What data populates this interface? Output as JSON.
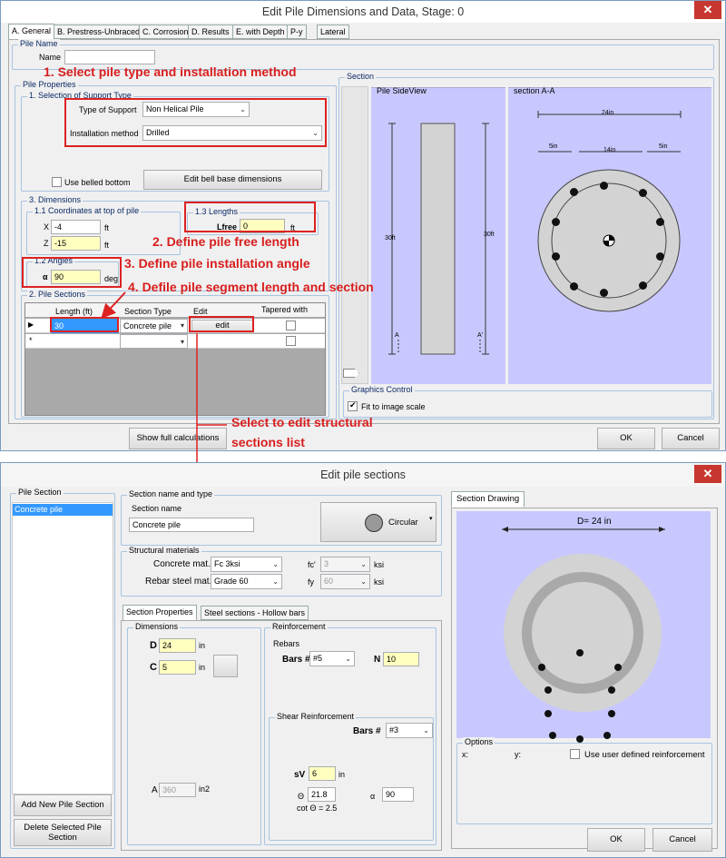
{
  "top_window": {
    "title": "Edit Pile Dimensions and Data, Stage: 0",
    "close_label": "✕",
    "tabs": [
      "A. General",
      "B. Prestress-Unbraced",
      "C. Corrosion",
      "D. Results",
      "E. with Depth",
      "P-y",
      "Lateral"
    ],
    "pile_name_group": "Pile Name",
    "name_label": "Name",
    "name_value": "",
    "pile_props_group": "Pile Properties",
    "support_group": "1. Selection of Support Type",
    "type_label": "Type of Support",
    "type_value": "Non Helical Pile",
    "install_label": "Installation method",
    "install_value": "Drilled",
    "belled_label": "Use belled bottom",
    "bell_button": "Edit bell base dimensions",
    "dims_group": "3. Dimensions",
    "coords_group": "1.1 Coordinates at top of pile",
    "x_label": "X",
    "x_value": "-4",
    "z_label": "Z",
    "z_value": "-15",
    "ft": "ft",
    "lengths_group": "1.3 Lengths",
    "lfree_label": "Lfree",
    "lfree_value": "0",
    "angles_group": "1.2 Angles",
    "alpha_label": "α",
    "alpha_value": "90",
    "deg": "deg",
    "sections_group": "2. Pile Sections",
    "table_headers": [
      "Length (ft)",
      "Section Type",
      "Edit",
      "Tapered with"
    ],
    "row1": {
      "length": "30",
      "section": "Concrete pile",
      "edit": "edit"
    },
    "new_row_marker": "*",
    "section_group": "Section",
    "side_view": "Pile SideView",
    "section_aa": "section A-A",
    "dim_24": "24in",
    "dim_5a": "5in",
    "dim_14": "14in",
    "dim_5b": "5in",
    "dim_30a": "30ft",
    "dim_30b": "30ft",
    "a_left": "A",
    "a_right": "A'",
    "graphics_group": "Graphics Control",
    "fit_label": "Fit to image scale",
    "show_calc": "Show full calculations",
    "ok": "OK",
    "cancel": "Cancel"
  },
  "annotations": {
    "a1": "1. Select pile type and installation method",
    "a2": "2. Define pile free length",
    "a3": "3. Define pile installation angle",
    "a4": "4. Defile pile segment length and section",
    "a5_line1": "Select to edit structural",
    "a5_line2": "sections list"
  },
  "bottom_window": {
    "title": "Edit pile sections",
    "close_label": "✕",
    "list_group": "Pile Section",
    "list_items": [
      "Concrete pile"
    ],
    "add_button": "Add New Pile Section",
    "delete_button": "Delete Selected Pile Section",
    "name_type_group": "Section name and type",
    "section_name_label": "Section name",
    "section_name_value": "Concrete pile",
    "shape_button": "Circular",
    "materials_group": "Structural materials",
    "concrete_label": "Concrete mat.",
    "concrete_value": "Fc 3ksi",
    "fc_label": "fc'",
    "fc_value": "3",
    "ksi": "ksi",
    "rebar_label": "Rebar steel mat.",
    "rebar_value": "Grade 60",
    "fy_label": "fy",
    "fy_value": "60",
    "tab_props": "Section Properties",
    "tab_steel": "Steel sections - Hollow bars",
    "dims_group": "Dimensions",
    "d_label": "D",
    "d_value": "24",
    "c_label": "C",
    "c_value": "5",
    "in": "in",
    "area_label": "A",
    "area_value": "360",
    "area_unit": "in2",
    "reinf_group": "Reinforcement",
    "rebars_label": "Rebars",
    "bars_label": "Bars #",
    "bars_value": "#5",
    "n_label": "N",
    "n_value": "10",
    "shear_group": "Shear Reinforcement",
    "shear_bars_value": "#3",
    "sv_label": "sV",
    "sv_value": "6",
    "theta_label": "Θ",
    "theta_value": "21.8",
    "alpha_label": "α",
    "alpha_value": "90",
    "cot_label": "cot Θ  = 2.5",
    "drawing_tab": "Section Drawing",
    "d_dim": "D= 24 in",
    "options_group": "Options",
    "x_label": "x:",
    "y_label": "y:",
    "user_reinf_label": "Use user defined reinforcement",
    "ok": "OK",
    "cancel": "Cancel"
  },
  "colors": {
    "annotation_red": "#d81e1e",
    "panel_blue": "#c8c8ff",
    "window_bg": "#f0f0f0"
  }
}
